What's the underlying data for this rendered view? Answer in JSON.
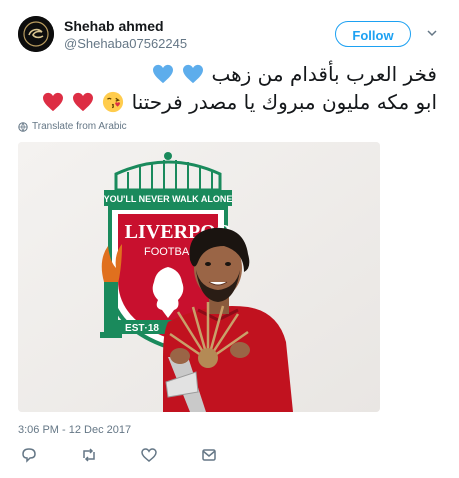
{
  "user": {
    "name": "Shehab ahmed",
    "handle": "@Shehaba07562245"
  },
  "follow_button": {
    "label": "Follow"
  },
  "tweet": {
    "line1": "فخر العرب بأقدام من زهب",
    "line2": "ابو مكه مليون مبروك يا مصدر فرحتنا"
  },
  "translate": {
    "label": "Translate from Arabic"
  },
  "media": {
    "banner_text": "YOU'LL NEVER WALK ALONE",
    "club_name": "LIVERPOO",
    "club_subtitle": "FOOTBALL C",
    "est_text": "EST·18"
  },
  "timestamp": "3:06 PM - 12 Dec 2017",
  "colors": {
    "accent": "#1da1f2",
    "liverpool_red": "#c8102e",
    "heart_blue": "#5dadec",
    "heart_red": "#dd2e44"
  },
  "icons": {
    "reply": "reply-icon",
    "retweet": "retweet-icon",
    "like": "like-icon",
    "message": "message-icon",
    "caret": "chevron-down-icon",
    "globe": "globe-icon"
  }
}
